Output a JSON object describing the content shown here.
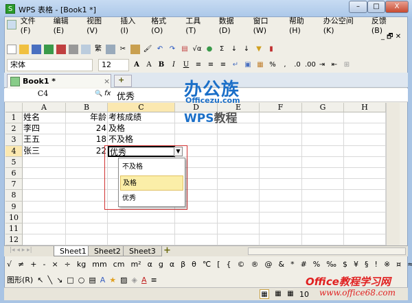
{
  "window": {
    "title": "WPS 表格 - [Book1 *]",
    "app_icon": "S",
    "minimize": "–",
    "maximize": "□",
    "close": "X"
  },
  "menu": [
    "文件(F)",
    "编辑(E)",
    "视图(V)",
    "插入(I)",
    "格式(O)",
    "工具(T)",
    "数据(D)",
    "窗口(W)",
    "帮助(H)",
    "办公空间(K)",
    "反馈(B)"
  ],
  "doc_controls": "_ 🗗 ✕",
  "toolbar1": [
    "new-icon",
    "open-icon",
    "save-icon",
    "export-icon",
    "pdf-icon",
    "print-icon",
    "preview-icon",
    "繁",
    "copy-icon",
    "cut-icon",
    "paste-icon",
    "format-painter-icon",
    "undo-icon",
    "redo-icon",
    "row-icon",
    "formula-icon",
    "Σ",
    "sort-asc-icon",
    "sort-desc-icon",
    "filter-icon",
    "chart-icon"
  ],
  "format": {
    "font": "宋体",
    "size": "12",
    "bold": "B",
    "italic": "I",
    "underline": "U",
    "percent": "%",
    "comma": ","
  },
  "doc_tab": {
    "label": "Book1 *",
    "close": "×",
    "new": "+"
  },
  "formula_bar": {
    "cell_ref": "C4",
    "fx": "fx",
    "value": "优秀"
  },
  "columns": [
    "A",
    "B",
    "C",
    "D",
    "E",
    "F",
    "G",
    "H"
  ],
  "rows": [
    "1",
    "2",
    "3",
    "4",
    "5",
    "6",
    "7",
    "8",
    "9",
    "10",
    "11",
    "12"
  ],
  "cells": [
    [
      "姓名",
      "年龄",
      "考核成绩"
    ],
    [
      "李四",
      "24",
      "及格"
    ],
    [
      "王五",
      "18",
      "不及格"
    ],
    [
      "张三",
      "22",
      "优秀"
    ]
  ],
  "dropdown": {
    "options": [
      "不及格",
      "及格",
      "优秀"
    ],
    "highlighted": "及格",
    "highlight_color": "#fbeea8"
  },
  "sheets": [
    "Sheet1",
    "Sheet2",
    "Sheet3"
  ],
  "active_sheet": "Sheet1",
  "symbols": [
    "√",
    "≠",
    "+",
    "-",
    "×",
    "÷",
    "kg",
    "mm",
    "cm",
    "m²",
    "α",
    "g",
    "α",
    "β",
    "θ",
    "℃",
    "[",
    "{",
    "©",
    "®",
    "@",
    "&",
    "*",
    "#",
    "%",
    "‰",
    "$",
    "¥",
    "§",
    "!",
    "※",
    "¤",
    "≈",
    "»"
  ],
  "draw_toolbar": {
    "shapes_label": "图形(R)"
  },
  "status": {
    "zoom": "10"
  },
  "watermarks": {
    "logo": "办公族",
    "logo_url": "Officezu.com",
    "logo_sub_wps": "WPS",
    "logo_sub": "教程",
    "site": "Office教程学习网",
    "site_url": "www.office68.com"
  },
  "colors": {
    "accent": "#1b6fc8",
    "selection_border": "#000000",
    "red_box": "#d03030"
  }
}
